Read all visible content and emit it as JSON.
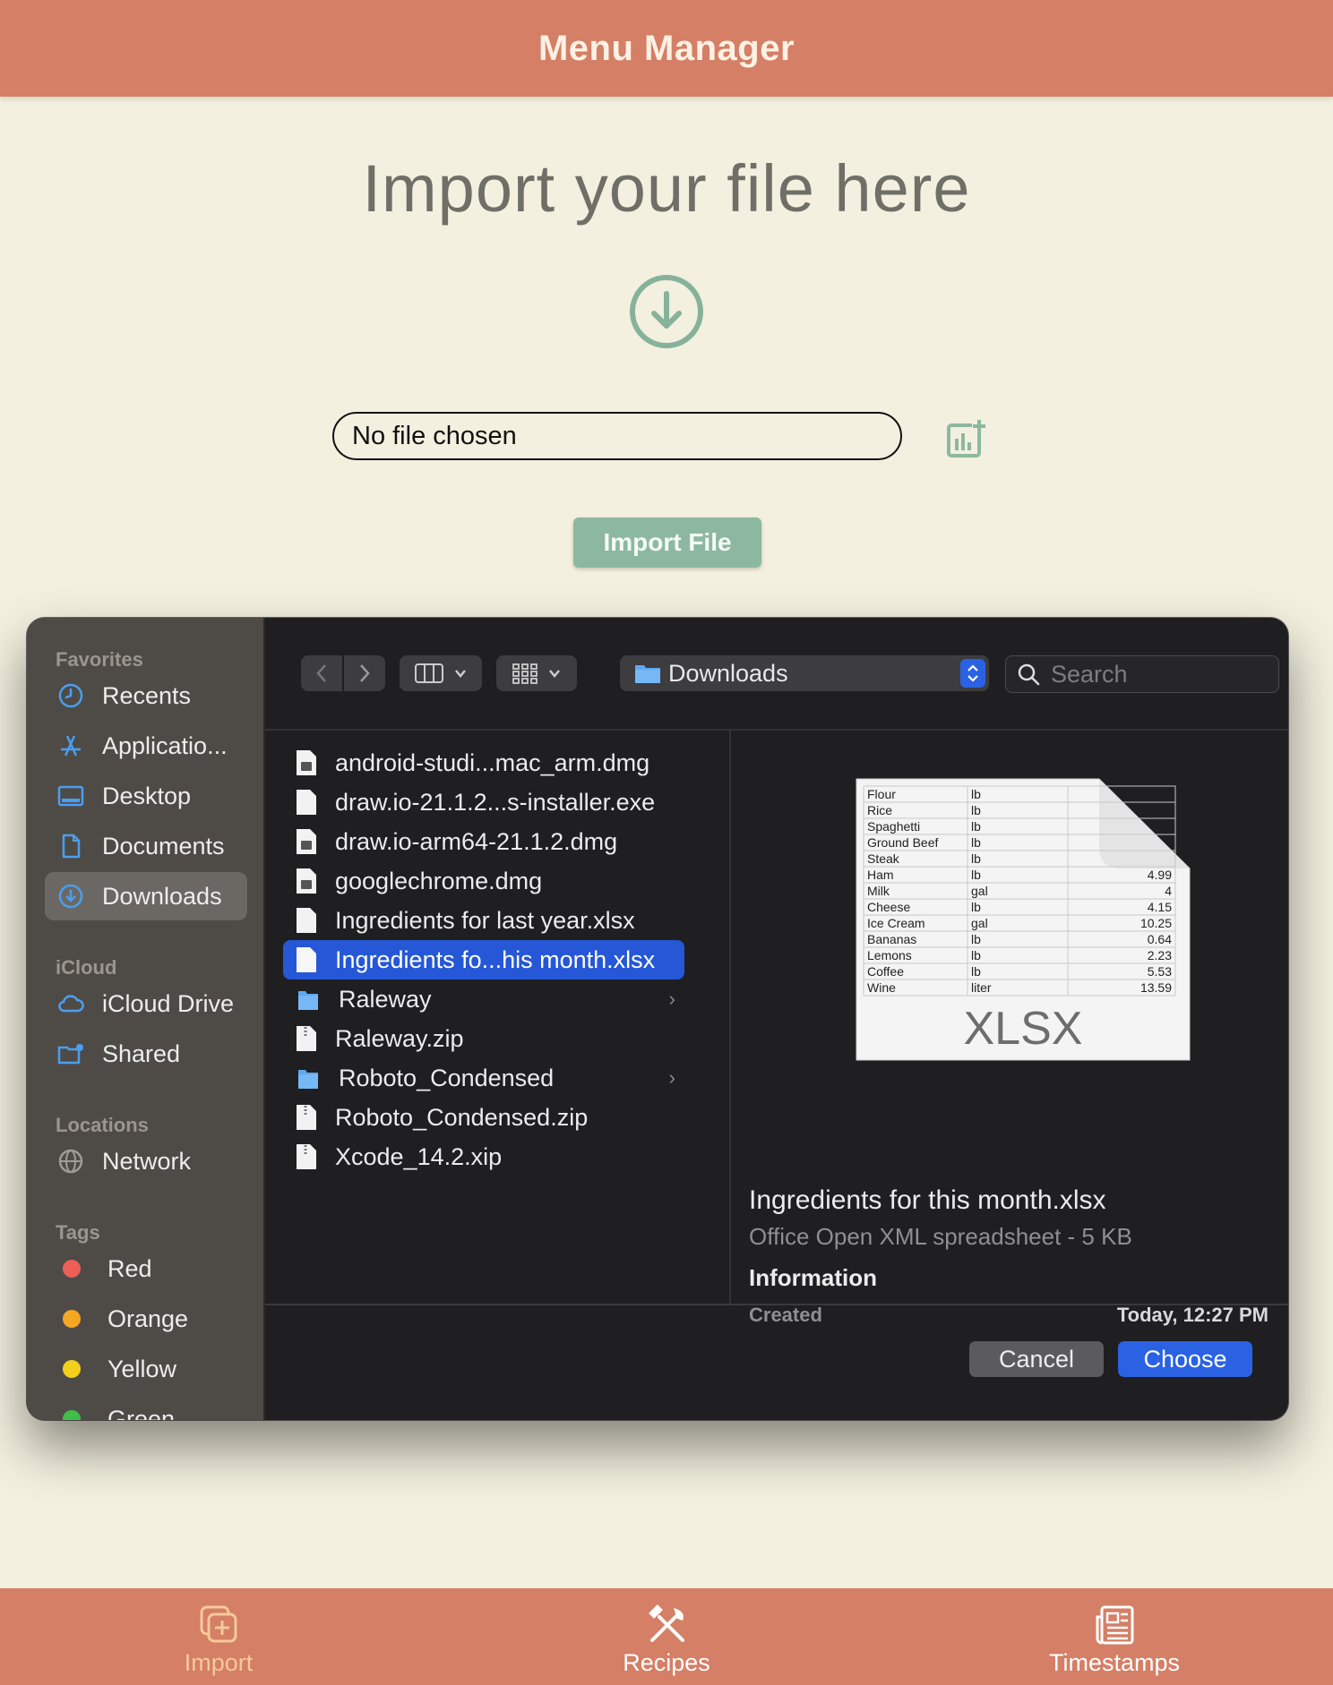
{
  "app": {
    "title": "Menu Manager"
  },
  "main": {
    "heading": "Import your file here",
    "file_field": "No file chosen",
    "import_button": "Import File"
  },
  "dialog": {
    "sidebar": {
      "favorites_title": "Favorites",
      "favorites": [
        {
          "label": "Recents",
          "icon": "clock-icon"
        },
        {
          "label": "Applicatio...",
          "icon": "applications-icon"
        },
        {
          "label": "Desktop",
          "icon": "desktop-icon"
        },
        {
          "label": "Documents",
          "icon": "document-icon"
        },
        {
          "label": "Downloads",
          "icon": "download-icon",
          "selected": true
        }
      ],
      "icloud_title": "iCloud",
      "icloud": [
        {
          "label": "iCloud Drive",
          "icon": "cloud-icon"
        },
        {
          "label": "Shared",
          "icon": "shared-folder-icon"
        }
      ],
      "locations_title": "Locations",
      "locations": [
        {
          "label": "Network",
          "icon": "globe-icon"
        }
      ],
      "tags_title": "Tags",
      "tags": [
        {
          "label": "Red",
          "color": "#ec5f57"
        },
        {
          "label": "Orange",
          "color": "#f5a623"
        },
        {
          "label": "Yellow",
          "color": "#f4d01d"
        },
        {
          "label": "Green",
          "color": "#3fbf4a"
        }
      ]
    },
    "toolbar": {
      "location": "Downloads",
      "search_placeholder": "Search"
    },
    "files": [
      {
        "name": "android-studi...mac_arm.dmg",
        "type": "disk-image"
      },
      {
        "name": "draw.io-21.1.2...s-installer.exe",
        "type": "document"
      },
      {
        "name": "draw.io-arm64-21.1.2.dmg",
        "type": "disk-image"
      },
      {
        "name": "googlechrome.dmg",
        "type": "disk-image"
      },
      {
        "name": "Ingredients for last year.xlsx",
        "type": "document"
      },
      {
        "name": "Ingredients fo...his month.xlsx",
        "type": "document",
        "selected": true
      },
      {
        "name": "Raleway",
        "type": "folder"
      },
      {
        "name": "Raleway.zip",
        "type": "archive"
      },
      {
        "name": "Roboto_Condensed",
        "type": "folder"
      },
      {
        "name": "Roboto_Condensed.zip",
        "type": "archive"
      },
      {
        "name": "Xcode_14.2.xip",
        "type": "archive"
      }
    ],
    "preview": {
      "thumb_rows": [
        [
          "Flour",
          "lb",
          ""
        ],
        [
          "Rice",
          "lb",
          ""
        ],
        [
          "Spaghetti",
          "lb",
          ""
        ],
        [
          "Ground Beef",
          "lb",
          ""
        ],
        [
          "Steak",
          "lb",
          ""
        ],
        [
          "Ham",
          "lb",
          "4.99"
        ],
        [
          "Milk",
          "gal",
          "4"
        ],
        [
          "Cheese",
          "lb",
          "4.15"
        ],
        [
          "Ice Cream",
          "gal",
          "10.25"
        ],
        [
          "Bananas",
          "lb",
          "0.64"
        ],
        [
          "Lemons",
          "lb",
          "2.23"
        ],
        [
          "Coffee",
          "lb",
          "5.53"
        ],
        [
          "Wine",
          "liter",
          "13.59"
        ]
      ],
      "thumb_label": "XLSX",
      "name": "Ingredients for this month.xlsx",
      "kind": "Office Open XML spreadsheet - 5 KB",
      "info_title": "Information",
      "created_label": "Created",
      "created_value": "Today, 12:27 PM"
    },
    "buttons": {
      "cancel": "Cancel",
      "choose": "Choose"
    }
  },
  "bottom_nav": {
    "items": [
      {
        "label": "Import",
        "icon": "import-icon",
        "active": true
      },
      {
        "label": "Recipes",
        "icon": "utensils-icon"
      },
      {
        "label": "Timestamps",
        "icon": "newspaper-icon"
      }
    ]
  },
  "colors": {
    "brand": "#d47f66",
    "background": "#f3f0df",
    "accent_green": "#8db8a0",
    "nav_active": "#f6c99a"
  }
}
